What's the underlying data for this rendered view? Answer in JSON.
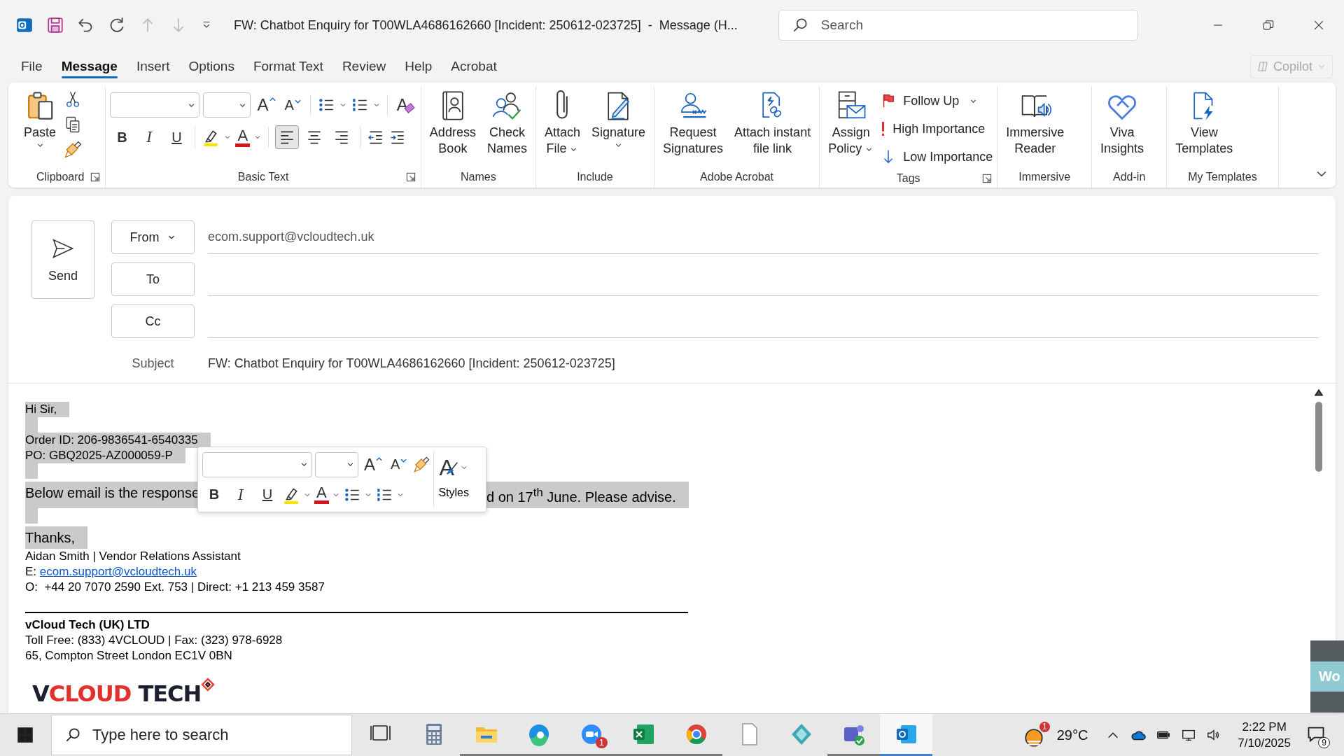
{
  "title_bar": {
    "quick_access": [
      {
        "disabled": false
      },
      {
        "disabled": false
      },
      {
        "disabled": true
      },
      {
        "disabled": true
      }
    ],
    "title": "FW: Chatbot Enquiry for T00WLA4686162660 [Incident: 250612-023725]  -  Message (H...",
    "search": {
      "placeholder": "Search"
    }
  },
  "menu": {
    "tabs": [
      {
        "label": "File",
        "selected": false
      },
      {
        "label": "Message",
        "selected": true
      },
      {
        "label": "Insert",
        "selected": false
      },
      {
        "label": "Options",
        "selected": false
      },
      {
        "label": "Format Text",
        "selected": false
      },
      {
        "label": "Review",
        "selected": false
      },
      {
        "label": "Help",
        "selected": false
      },
      {
        "label": "Acrobat",
        "selected": false
      }
    ],
    "copilot": {
      "label": "Copilot",
      "disabled": true
    }
  },
  "ribbon": {
    "clipboard": {
      "label": "Clipboard",
      "launcher": true,
      "paste": {
        "label": "Paste",
        "dropdown": true
      }
    },
    "basic_text": {
      "label": "Basic Text",
      "launcher": true,
      "glyphs": {
        "grow": "A",
        "shrink": "A",
        "clear": "A",
        "text_a": "A"
      },
      "format_buttons": [
        "B",
        "I",
        "U"
      ],
      "alignment": [
        {
          "selected": true
        },
        {
          "selected": false
        },
        {
          "selected": false
        }
      ]
    },
    "large_groups": [
      {
        "label": "Names",
        "buttons": [
          {
            "label": "Address\nBook"
          },
          {
            "label": "Check\nNames"
          }
        ]
      },
      {
        "label": "Include",
        "buttons": [
          {
            "label": "Attach\nFile",
            "dropdown": true
          },
          {
            "label": "Signature",
            "dropdown": true
          }
        ]
      },
      {
        "label": "Adobe Acrobat",
        "buttons": [
          {
            "label": "Request\nSignatures"
          },
          {
            "label": "Attach instant\nfile link"
          }
        ]
      }
    ],
    "tags": {
      "label": "Tags",
      "launcher": true,
      "assign": {
        "label": "Assign\nPolicy",
        "dropdown": true
      },
      "items": [
        {
          "label": "Follow Up",
          "dropdown": true
        },
        {
          "label": "High Importance"
        },
        {
          "label": "Low Importance"
        }
      ]
    },
    "tail_groups": [
      {
        "label": "Immersive",
        "buttons": [
          {
            "label": "Immersive\nReader"
          }
        ]
      },
      {
        "label": "Add-in",
        "buttons": [
          {
            "label": "Viva\nInsights"
          }
        ]
      },
      {
        "label": "My Templates",
        "buttons": [
          {
            "label": "View\nTemplates"
          }
        ]
      }
    ]
  },
  "compose": {
    "send": "Send",
    "from": {
      "label": "From",
      "value": "ecom.support@vcloudtech.uk"
    },
    "to": {
      "label": "To"
    },
    "cc": {
      "label": "Cc"
    },
    "subject": {
      "label": "Subject",
      "value": "FW: Chatbot Enquiry for T00WLA4686162660 [Incident: 250612-023725]"
    }
  },
  "body": {
    "lines": [
      {
        "kind": "small",
        "text": "Hi Sir,",
        "selected": true
      },
      {
        "kind": "blank",
        "selected": true
      },
      {
        "kind": "small",
        "text": "Order ID: 206-9836541-6540335",
        "selected": true
      },
      {
        "kind": "small",
        "text": "PO: GBQ2025-AZ000059-P",
        "selected": true
      },
      {
        "kind": "blank",
        "selected": true
      },
      {
        "kind": "split",
        "parts": [
          "Below email is the response",
          "d on 17$^{th}$ June. Please advise."
        ],
        "selected": true
      },
      {
        "kind": "blank",
        "selected": true
      },
      {
        "kind": "large",
        "text": "Thanks,",
        "selected": true
      }
    ],
    "signature": {
      "name_line": "Aidan Smith | Vendor Relations Assistant",
      "email_label": "E:",
      "email": "ecom.support@vcloudtech.uk",
      "phone_line": "O:  +44 20 7070 2590 Ext. 753 | Direct: +1 213 459 3587",
      "company": "vCloud Tech (UK) LTD",
      "toll_free": "Toll Free: (833) 4VCLOUD | Fax: (323) 978-6928",
      "address": "65, Compton Street London EC1V 0BN",
      "logo": [
        "V",
        "CLOUD",
        " TECH"
      ]
    }
  },
  "mini_toolbar": {
    "glyphs": {
      "grow": "A",
      "shrink": "A",
      "text_a": "A",
      "styles": "A"
    },
    "format_buttons": [
      "B",
      "I",
      "U"
    ],
    "styles": "Styles"
  },
  "side_window": {
    "label": "Wo"
  },
  "taskbar": {
    "search_placeholder": "Type here to search",
    "apps": [
      {
        "running": false,
        "selected": false
      },
      {
        "running": false,
        "selected": false
      },
      {
        "running": true,
        "selected": false
      },
      {
        "running": true,
        "selected": false
      },
      {
        "running": true,
        "selected": false,
        "badge": "1"
      },
      {
        "running": true,
        "selected": false
      },
      {
        "running": true,
        "selected": false
      },
      {
        "running": false,
        "selected": false
      },
      {
        "running": false,
        "selected": false
      },
      {
        "running": true,
        "selected": false
      },
      {
        "running": true,
        "selected": true
      }
    ],
    "weather": {
      "badge": "1",
      "temperature": "29°C"
    },
    "time": "2:22 PM",
    "date": "7/10/2025",
    "notifications": "9"
  }
}
